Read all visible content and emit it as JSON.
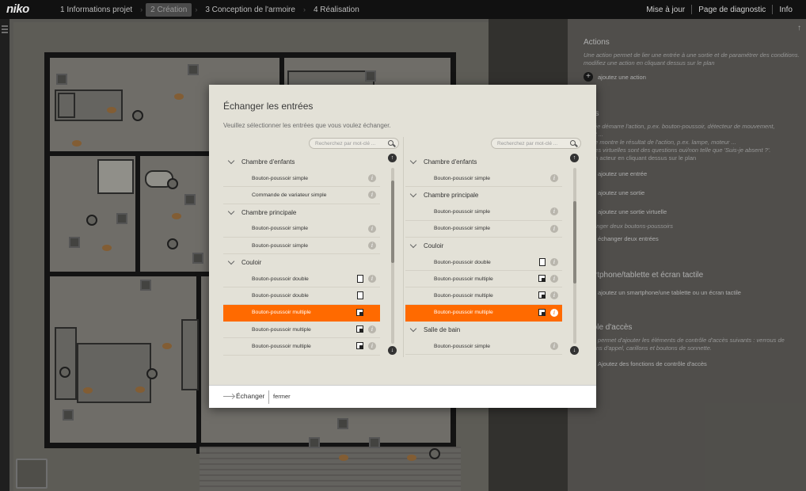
{
  "topbar": {
    "logo": "niko",
    "steps": [
      "1 Informations projet",
      "2 Création",
      "3 Conception de l'armoire",
      "4 Réalisation"
    ],
    "active_step": 1,
    "links": [
      "Mise à jour",
      "Page de diagnostic",
      "Info"
    ]
  },
  "right_panel": {
    "up_glyph": "↑",
    "actions_title": "Actions",
    "actions_text_1": "Une action permet de lier une entrée à une sortie et de paramétrer des conditions.",
    "actions_text_2": "modifiez une action en cliquant dessus sur le plan",
    "actions_add": "ajoutez une action",
    "acteurs_title": "eurs",
    "acteurs_text_1": "entrée démarre l'action, p.ex. bouton-poussoir, détecteur de mouvement,",
    "acteurs_text_2": "ment ...",
    "acteurs_text_3": "sortie montre le résultat de l'action, p.ex. lampe, moteur ...",
    "acteurs_text_4": "sorties virtuelles sont des questions oui/non telle que 'Suis-je absent ?'.",
    "acteurs_text_5": "ez un acteur en cliquant dessus sur le plan",
    "add_input": "ajoutez une entrée",
    "add_output": "ajoutez une sortie",
    "add_virtual": "ajoutez une sortie virtuelle",
    "swap_text": "échanger deux boutons-poussoirs",
    "swap_action": "échanger deux entrées",
    "smart_title": "martphone/tablette et écran tactile",
    "smart_add": "ajoutez un smartphone/une tablette ou un écran tactile",
    "access_title": "ntrôle d'accès",
    "access_text_1": "vous permet d'ajouter les éléments de contrôle d'accès suivants : verrous de",
    "access_text_2": "actions d'appel, carillons et boutons de sonnette.",
    "access_add": "Ajoutez des fonctions de contrôle d'accès"
  },
  "dialog": {
    "title": "Échanger les entrées",
    "subtitle": "Veuillez sélectionner les entrées que vous voulez échanger.",
    "search_placeholder": "Recherchez par mot-clé ...",
    "left_list": [
      {
        "type": "group",
        "label": "Chambre d'enfants"
      },
      {
        "type": "item",
        "label": "Bouton-poussoir simple",
        "icon": "",
        "info": true
      },
      {
        "type": "item",
        "label": "Commande de variateur simple",
        "icon": "",
        "info": true
      },
      {
        "type": "group",
        "label": "Chambre principale"
      },
      {
        "type": "item",
        "label": "Bouton-poussoir simple",
        "icon": "",
        "info": true
      },
      {
        "type": "item",
        "label": "Bouton-poussoir simple",
        "icon": "",
        "info": true
      },
      {
        "type": "group",
        "label": "Couloir"
      },
      {
        "type": "item",
        "label": "Bouton-poussoir double",
        "icon": "double",
        "info": true
      },
      {
        "type": "item",
        "label": "Bouton-poussoir double",
        "icon": "double",
        "info": false
      },
      {
        "type": "item",
        "label": "Bouton-poussoir multiple",
        "icon": "multi",
        "info": false,
        "selected": true
      },
      {
        "type": "item",
        "label": "Bouton-poussoir multiple",
        "icon": "multi",
        "info": true
      },
      {
        "type": "item",
        "label": "Bouton-poussoir multiple",
        "icon": "multi",
        "info": true
      }
    ],
    "right_list": [
      {
        "type": "group",
        "label": "Chambre d'enfants"
      },
      {
        "type": "item",
        "label": "Bouton-poussoir simple",
        "icon": "",
        "info": true
      },
      {
        "type": "group",
        "label": "Chambre principale"
      },
      {
        "type": "item",
        "label": "Bouton-poussoir simple",
        "icon": "",
        "info": true
      },
      {
        "type": "item",
        "label": "Bouton-poussoir simple",
        "icon": "",
        "info": true
      },
      {
        "type": "group",
        "label": "Couloir"
      },
      {
        "type": "item",
        "label": "Bouton-poussoir double",
        "icon": "double",
        "info": true
      },
      {
        "type": "item",
        "label": "Bouton-poussoir multiple",
        "icon": "multi",
        "info": true
      },
      {
        "type": "item",
        "label": "Bouton-poussoir multiple",
        "icon": "multi",
        "info": true
      },
      {
        "type": "item",
        "label": "Bouton-poussoir multiple",
        "icon": "multi",
        "info": true,
        "selected": true
      },
      {
        "type": "group",
        "label": "Salle de bain"
      },
      {
        "type": "item",
        "label": "Bouton-poussoir simple",
        "icon": "",
        "info": true
      }
    ],
    "swap_label": "Échanger",
    "close_label": "fermer",
    "scroll_up_glyph": "↑",
    "scroll_down_glyph": "↓",
    "info_glyph": "i"
  },
  "colors": {
    "accent": "#ff6a00",
    "topbar": "#111111",
    "dialog": "#e3e1d7"
  },
  "icons": [
    "menu-icon",
    "search-icon",
    "info-icon",
    "chevron-down-icon",
    "arrow-up-icon",
    "arrow-down-icon",
    "arrow-right-icon",
    "plus-icon"
  ]
}
